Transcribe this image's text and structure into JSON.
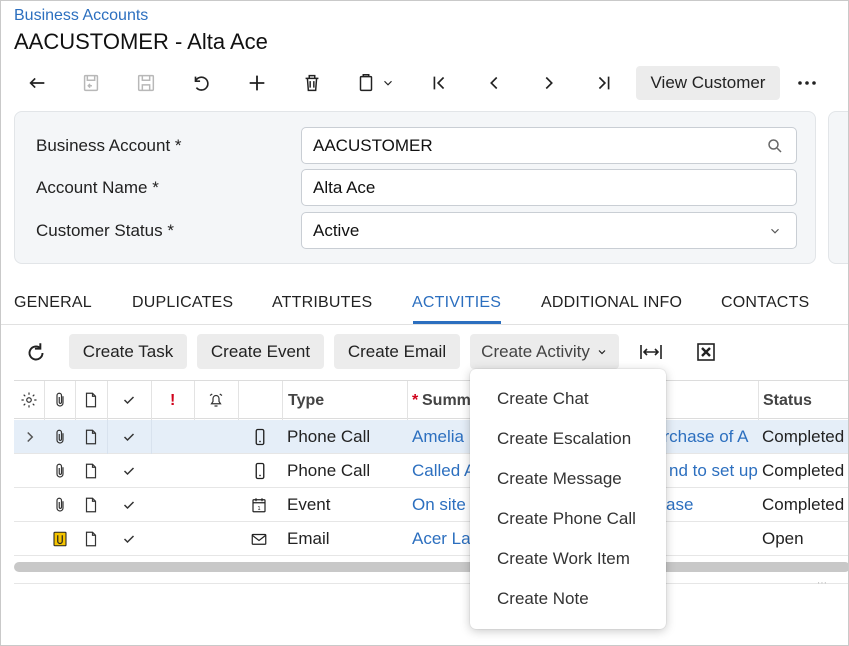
{
  "header": {
    "breadcrumb": "Business Accounts",
    "title": "AACUSTOMER - Alta Ace"
  },
  "toolbar": {
    "icons": [
      "back-icon",
      "save-close-icon",
      "save-icon",
      "undo-icon",
      "add-icon",
      "delete-icon",
      "copy-paste-icon",
      "first-record-icon",
      "prev-record-icon",
      "next-record-icon",
      "last-record-icon"
    ],
    "view_customer_label": "View Customer",
    "more_icon": "more-icon"
  },
  "form": {
    "business_account": {
      "label": "Business Account *",
      "value": "AACUSTOMER"
    },
    "account_name": {
      "label": "Account Name *",
      "value": "Alta Ace"
    },
    "customer_status": {
      "label": "Customer Status *",
      "value": "Active"
    }
  },
  "tabs": [
    {
      "label": "GENERAL"
    },
    {
      "label": "DUPLICATES"
    },
    {
      "label": "ATTRIBUTES"
    },
    {
      "label": "ACTIVITIES"
    },
    {
      "label": "ADDITIONAL INFO"
    },
    {
      "label": "CONTACTS"
    }
  ],
  "active_tab": "ACTIVITIES",
  "grid_toolbar": {
    "create_task": "Create Task",
    "create_event": "Create Event",
    "create_email": "Create Email",
    "create_activity": "Create Activity"
  },
  "grid": {
    "headers": {
      "type": "Type",
      "summary_marker": "*",
      "summary": "Summ",
      "status": "Status"
    },
    "rows": [
      {
        "type": "Phone Call",
        "summary": "Amelia",
        "summary_tail": "urchase of A",
        "status": "Completed"
      },
      {
        "type": "Phone Call",
        "summary": "Called A",
        "summary_tail": "nd to set up",
        "status": "Completed"
      },
      {
        "type": "Event",
        "summary": "On site",
        "summary_tail": "ase",
        "status": "Completed"
      },
      {
        "type": "Email",
        "summary": "Acer La",
        "summary_tail": "",
        "status": "Open"
      }
    ]
  },
  "dropdown_menu": {
    "items": [
      "Create Chat",
      "Create Escalation",
      "Create Message",
      "Create Phone Call",
      "Create Work Item",
      "Create Note"
    ]
  },
  "colors": {
    "accent": "#2c6fbf",
    "selected_row": "#e5eef8",
    "button_bg": "#ececec",
    "required_mark": "#d0021b"
  }
}
